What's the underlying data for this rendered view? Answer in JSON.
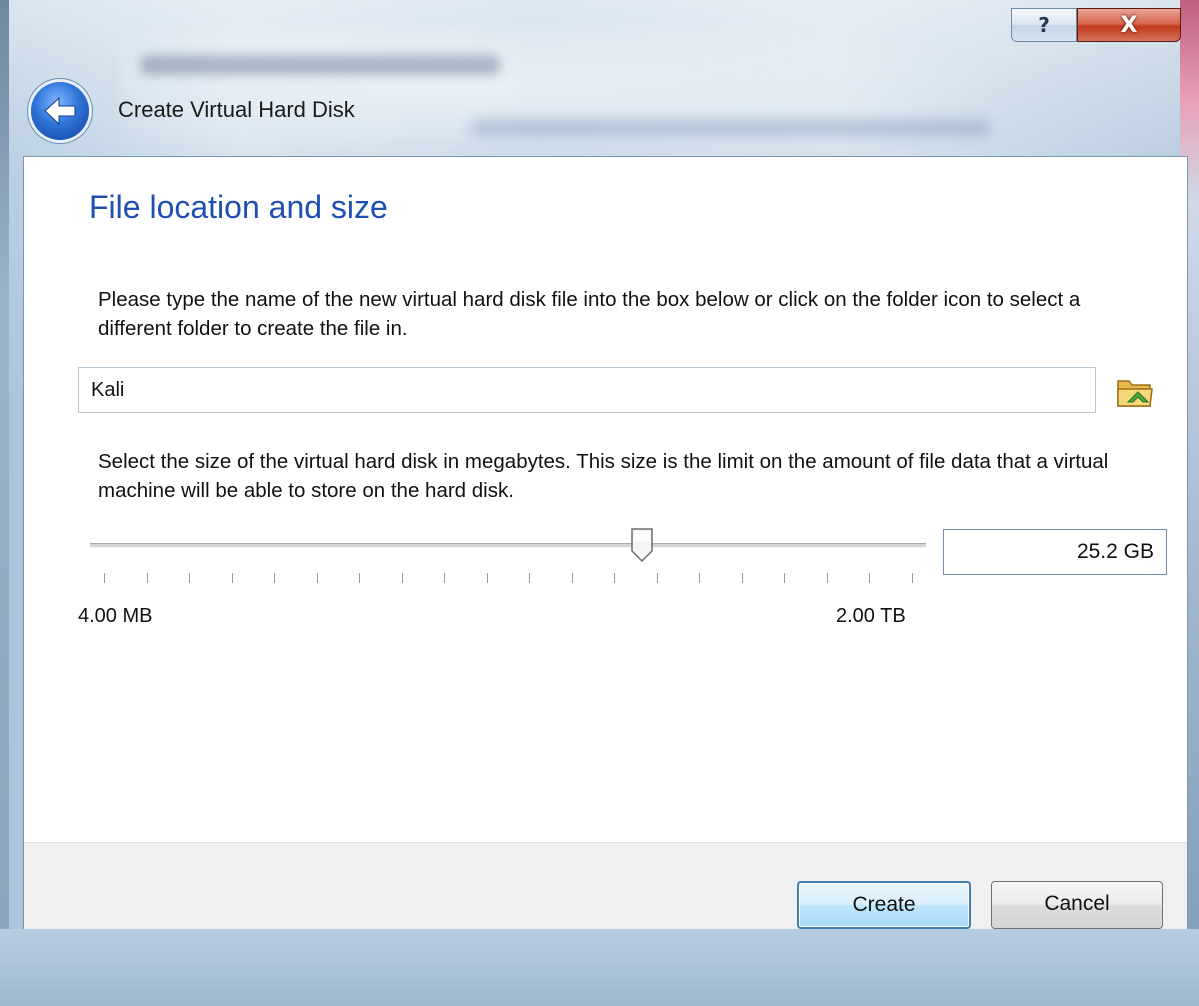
{
  "window": {
    "help_label": "?",
    "close_label": "X"
  },
  "header": {
    "title": "Create Virtual Hard Disk"
  },
  "page": {
    "heading": "File location and size",
    "location_description": "Please type the name of the new virtual hard disk file into the box below or click on the folder icon to select a different folder to create the file in.",
    "file_name_value": "Kali",
    "size_description": "Select the size of the virtual hard disk in megabytes. This size is the limit on the amount of file data that a virtual machine will be able to store on the hard disk.",
    "slider": {
      "min_label": "4.00 MB",
      "max_label": "2.00 TB",
      "position_fraction": 0.66,
      "tick_count": 20
    },
    "size_value": "25.2 GB"
  },
  "footer": {
    "create_label": "Create",
    "cancel_label": "Cancel"
  },
  "icons": {
    "back": "back-arrow-icon",
    "folder": "folder-icon"
  },
  "colors": {
    "heading": "#1f4fb3",
    "close_button": "#c0391c",
    "default_button_border": "#3c7fb1"
  }
}
